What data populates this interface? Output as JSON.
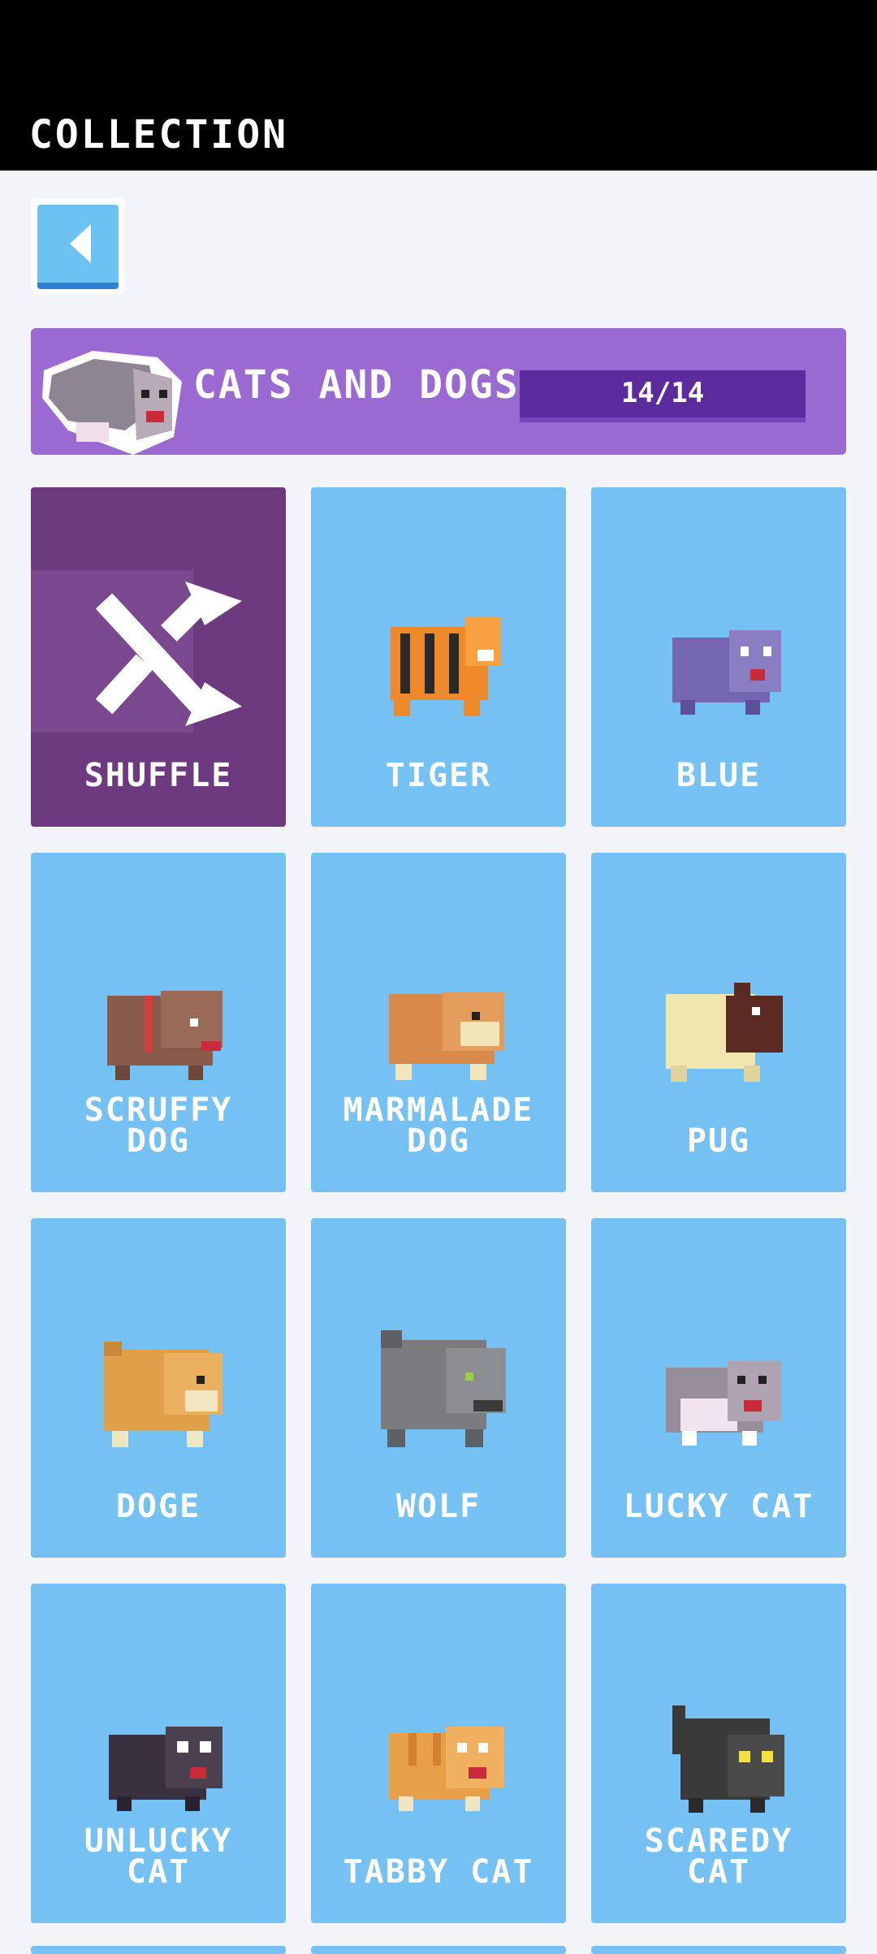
{
  "header": {
    "title": "COLLECTION"
  },
  "banner": {
    "name": "CATS AND DOGS",
    "progress": "14/14"
  },
  "cards": [
    {
      "label": "SHUFFLE",
      "icon": "shuffle-icon"
    },
    {
      "label": "TIGER",
      "icon": "tiger-icon"
    },
    {
      "label": "BLUE",
      "icon": "blue-cat-icon"
    },
    {
      "label": "SCRUFFY\nDOG",
      "icon": "scruffy-dog-icon"
    },
    {
      "label": "MARMALADE\nDOG",
      "icon": "marmalade-dog-icon"
    },
    {
      "label": "PUG",
      "icon": "pug-icon"
    },
    {
      "label": "DOGE",
      "icon": "doge-icon"
    },
    {
      "label": "WOLF",
      "icon": "wolf-icon"
    },
    {
      "label": "LUCKY CAT",
      "icon": "lucky-cat-icon"
    },
    {
      "label": "UNLUCKY\nCAT",
      "icon": "unlucky-cat-icon"
    },
    {
      "label": "TABBY CAT",
      "icon": "tabby-cat-icon"
    },
    {
      "label": "SCAREDY\nCAT",
      "icon": "scaredy-cat-icon"
    }
  ],
  "colors": {
    "card": "#75c1f3",
    "shuffle_card": "#6d3a80",
    "banner": "#9a69d1",
    "progress": "#5b2b9e"
  }
}
